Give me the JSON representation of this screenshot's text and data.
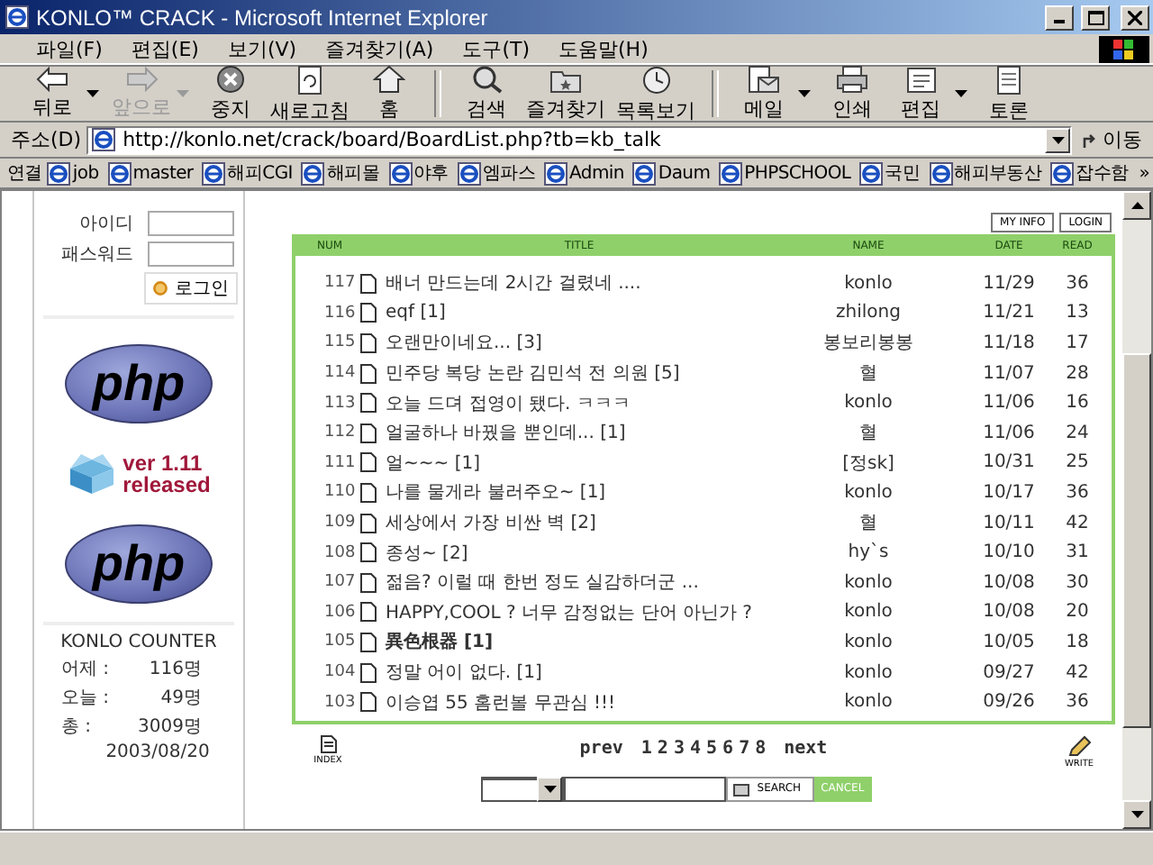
{
  "window": {
    "title": "KONLO™ CRACK - Microsoft Internet Explorer"
  },
  "menu": [
    "파일(F)",
    "편집(E)",
    "보기(V)",
    "즐겨찾기(A)",
    "도구(T)",
    "도움말(H)"
  ],
  "toolbar": [
    {
      "kind": "back",
      "label": "뒤로",
      "disabled": false,
      "dropdown": true
    },
    {
      "kind": "forward",
      "label": "앞으로",
      "disabled": true,
      "dropdown": true
    },
    {
      "kind": "stop",
      "label": "중지",
      "disabled": false,
      "dropdown": false
    },
    {
      "kind": "refresh",
      "label": "새로고침",
      "disabled": false,
      "dropdown": false
    },
    {
      "kind": "home",
      "label": "홈",
      "disabled": false,
      "dropdown": false
    },
    {
      "kind": "sep"
    },
    {
      "kind": "search",
      "label": "검색",
      "disabled": false,
      "dropdown": false
    },
    {
      "kind": "favorites",
      "label": "즐겨찾기",
      "disabled": false,
      "dropdown": false
    },
    {
      "kind": "history",
      "label": "목록보기",
      "disabled": false,
      "dropdown": false
    },
    {
      "kind": "sep"
    },
    {
      "kind": "mail",
      "label": "메일",
      "disabled": false,
      "dropdown": true
    },
    {
      "kind": "print",
      "label": "인쇄",
      "disabled": false,
      "dropdown": false
    },
    {
      "kind": "edit",
      "label": "편집",
      "disabled": false,
      "dropdown": true
    },
    {
      "kind": "discuss",
      "label": "토론",
      "disabled": false,
      "dropdown": false
    }
  ],
  "address": {
    "label": "주소(D)",
    "url": "http://konlo.net/crack/board/BoardList.php?tb=kb_talk",
    "go": "이동"
  },
  "links": {
    "label": "연결",
    "items": [
      "job",
      "master",
      "해피CGI",
      "해피몰",
      "야후",
      "엠파스",
      "Admin",
      "Daum",
      "PHPSCHOOL",
      "국민",
      "해피부동산",
      "잡수함"
    ],
    "more": "»"
  },
  "sidebar": {
    "login": {
      "id_label": "아이디",
      "pw_label": "패스워드",
      "button": "로그인"
    },
    "banners": [
      {
        "kind": "php",
        "text": "php"
      },
      {
        "kind": "release",
        "lines": [
          "ver 1.11",
          "released"
        ]
      },
      {
        "kind": "php",
        "text": "php"
      }
    ],
    "counter": {
      "title": "KONLO COUNTER",
      "rows": [
        {
          "label": "어제 :",
          "value": "116명"
        },
        {
          "label": "오늘 :",
          "value": "49명"
        },
        {
          "label": "총 :",
          "value": "3009명"
        }
      ],
      "date": "2003/08/20"
    }
  },
  "board": {
    "top_buttons": [
      "MY INFO",
      "LOGIN"
    ],
    "columns": [
      "NUM",
      "TITLE",
      "NAME",
      "DATE",
      "READ"
    ],
    "rows": [
      {
        "num": "117",
        "title": "배너 만드는데 2시간 걸렸네 ....",
        "name": "konlo",
        "date": "11/29",
        "read": "36",
        "bold": false
      },
      {
        "num": "116",
        "title": "eqf [1]",
        "name": "zhilong",
        "date": "11/21",
        "read": "13",
        "bold": false
      },
      {
        "num": "115",
        "title": "오랜만이네요... [3]",
        "name": "봉보리봉봉",
        "date": "11/18",
        "read": "17",
        "bold": false
      },
      {
        "num": "114",
        "title": "민주당 복당 논란 김민석 전 의원 [5]",
        "name": "혈",
        "date": "11/07",
        "read": "28",
        "bold": false
      },
      {
        "num": "113",
        "title": "오늘 드뎌 접영이 됐다. ㅋㅋㅋ",
        "name": "konlo",
        "date": "11/06",
        "read": "16",
        "bold": false
      },
      {
        "num": "112",
        "title": "얼굴하나 바꿨을 뿐인데... [1]",
        "name": "혈",
        "date": "11/06",
        "read": "24",
        "bold": false
      },
      {
        "num": "111",
        "title": "얼~~~ [1]",
        "name": "[정sk]",
        "date": "10/31",
        "read": "25",
        "bold": false
      },
      {
        "num": "110",
        "title": "나를 물게라 불러주오~ [1]",
        "name": "konlo",
        "date": "10/17",
        "read": "36",
        "bold": false
      },
      {
        "num": "109",
        "title": "세상에서 가장 비싼 벽 [2]",
        "name": "혈",
        "date": "10/11",
        "read": "42",
        "bold": false
      },
      {
        "num": "108",
        "title": "종성~ [2]",
        "name": "hy`s",
        "date": "10/10",
        "read": "31",
        "bold": false
      },
      {
        "num": "107",
        "title": "젊음? 이럴 때 한번 정도 실감하더군 ...",
        "name": "konlo",
        "date": "10/08",
        "read": "30",
        "bold": false
      },
      {
        "num": "106",
        "title": "HAPPY,COOL ? 너무 감정없는 단어 아닌가 ?",
        "name": "konlo",
        "date": "10/08",
        "read": "20",
        "bold": false
      },
      {
        "num": "105",
        "title": "異色根器 [1]",
        "name": "konlo",
        "date": "10/05",
        "read": "18",
        "bold": true
      },
      {
        "num": "104",
        "title": "정말 어이 없다. [1]",
        "name": "konlo",
        "date": "09/27",
        "read": "42",
        "bold": false
      },
      {
        "num": "103",
        "title": "이승엽 55 홈런볼 무관심 !!!",
        "name": "konlo",
        "date": "09/26",
        "read": "36",
        "bold": false
      }
    ],
    "index_label": "INDEX",
    "write_label": "WRITE",
    "pages": {
      "prev": "prev",
      "numbers": [
        "1",
        "2",
        "3",
        "4",
        "5",
        "6",
        "7",
        "8"
      ],
      "next": "next"
    },
    "search": {
      "button": "SEARCH",
      "cancel": "CANCEL"
    }
  }
}
